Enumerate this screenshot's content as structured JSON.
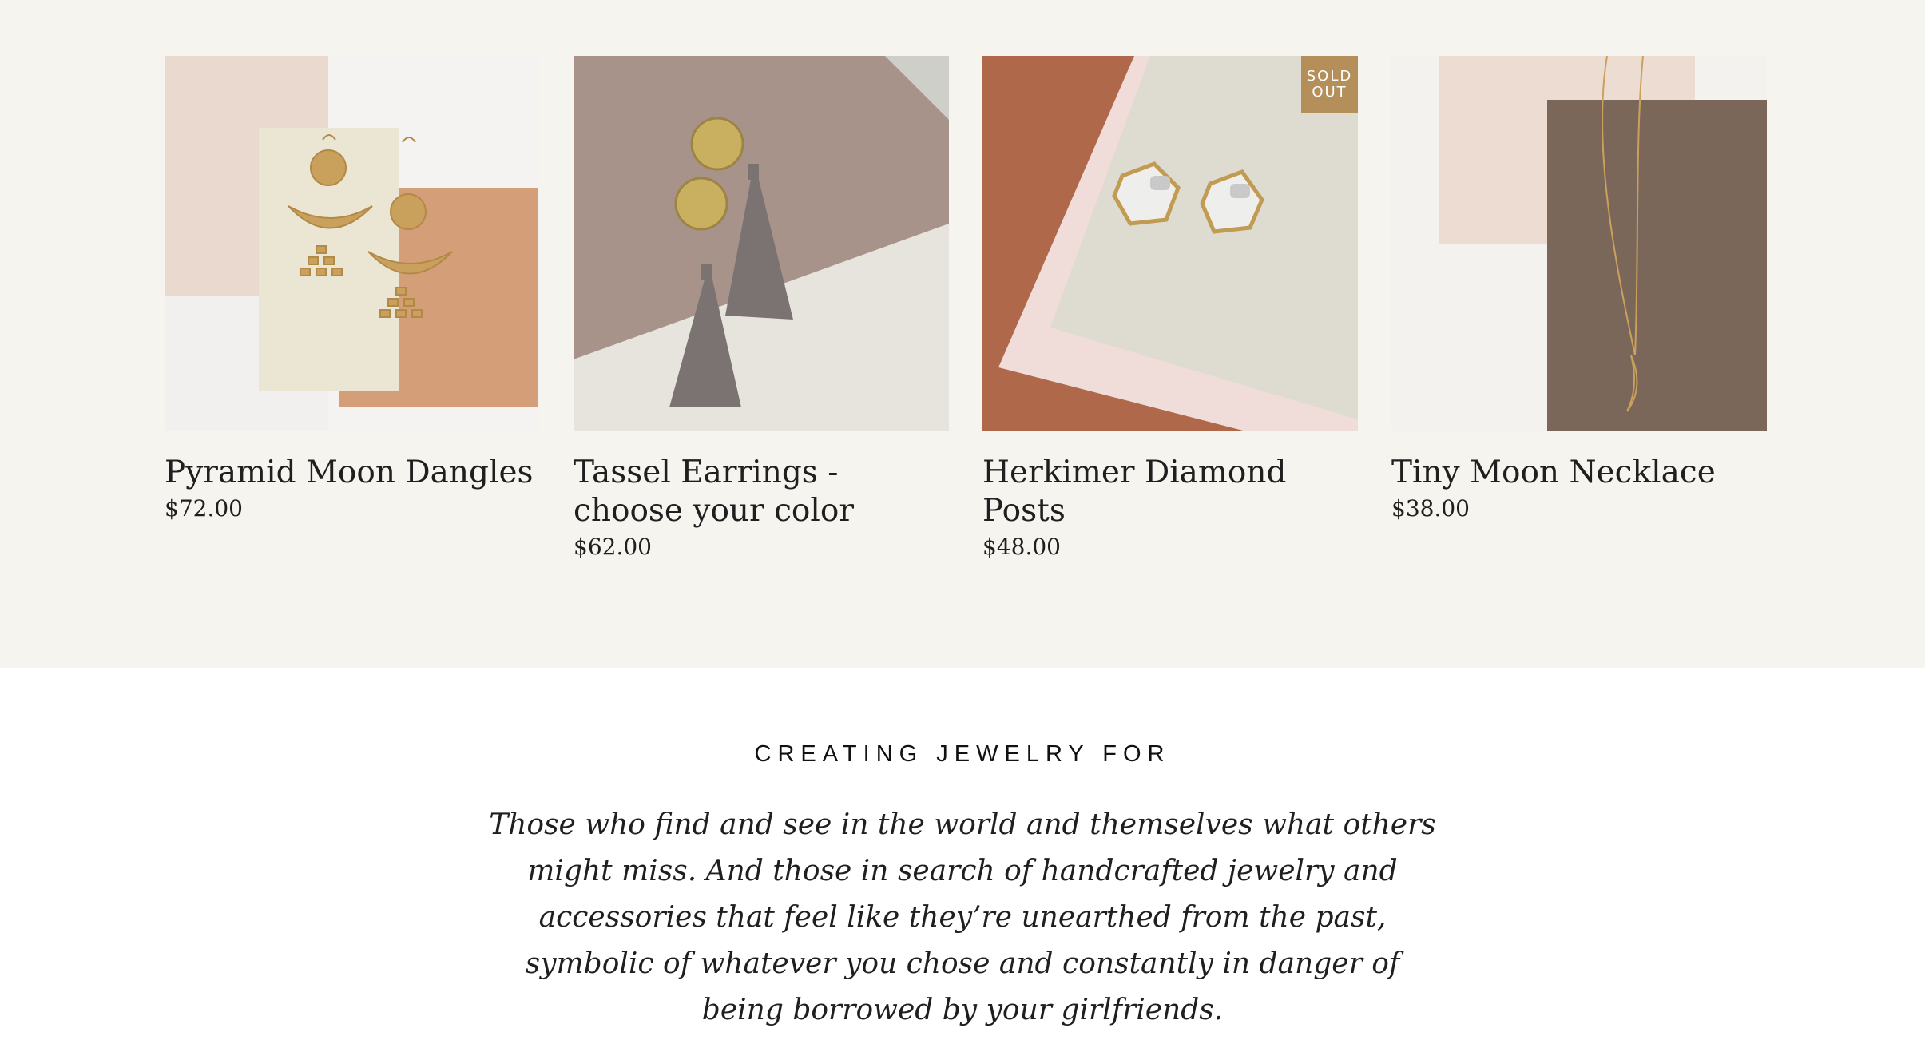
{
  "products": [
    {
      "title": "Pyramid Moon Dangles",
      "price": "$72.00",
      "image_icon": "pyramid-moon-earrings-photo"
    },
    {
      "title": "Tassel Earrings - choose your color",
      "price": "$62.00",
      "image_icon": "tassel-earrings-photo"
    },
    {
      "title": "Herkimer Diamond Posts",
      "price": "$48.00",
      "image_icon": "herkimer-diamond-posts-photo",
      "badge": "SOLD OUT"
    },
    {
      "title": "Tiny Moon Necklace",
      "price": "$38.00",
      "image_icon": "tiny-moon-necklace-photo"
    }
  ],
  "about": {
    "eyebrow": "CREATING JEWELRY FOR",
    "text": "Those who find and see in the world and themselves what others might miss. And those in search of handcrafted jewelry and accessories that feel like they’re unearthed from the past, symbolic of whatever you chose and constantly in danger of being borrowed by your girlfriends."
  },
  "colors": {
    "section_bg": "#f5f4ef",
    "badge_bg": "#b48f5a",
    "text": "#1f1f1f"
  }
}
